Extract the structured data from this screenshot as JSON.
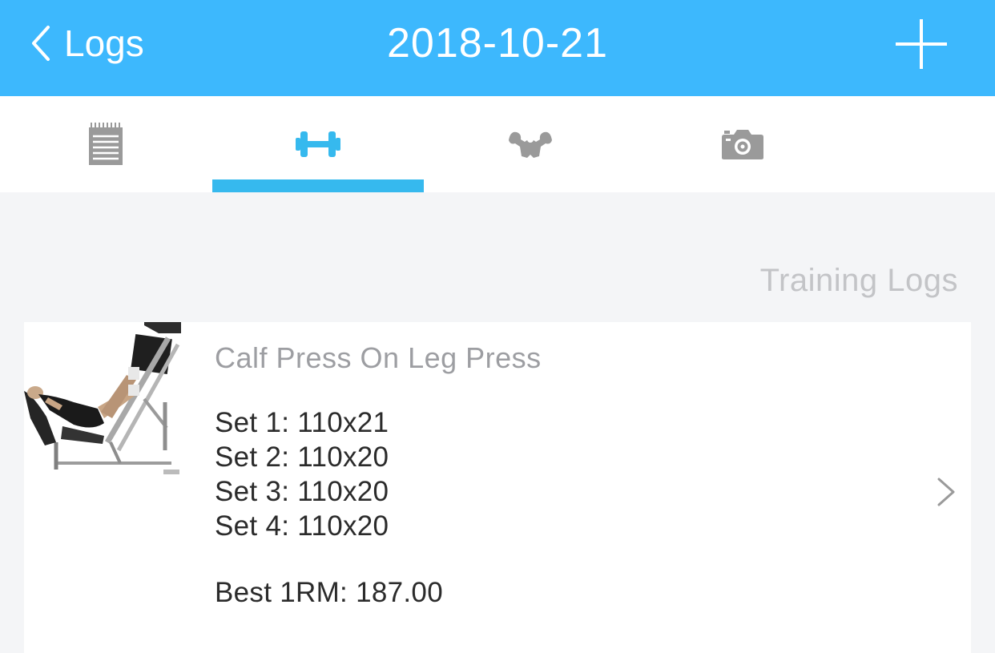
{
  "nav": {
    "back_label": "Logs",
    "title": "2018-10-21",
    "add_icon": "plus-icon",
    "bar_color": "#3db8fd"
  },
  "tabs": [
    {
      "icon": "notepad-icon",
      "active": false
    },
    {
      "icon": "dumbbell-icon",
      "active": true
    },
    {
      "icon": "muscle-icon",
      "active": false
    },
    {
      "icon": "camera-icon",
      "active": false
    }
  ],
  "colors": {
    "active_tab": "#36b9ee",
    "inactive_tab": "#9a9a9a"
  },
  "section": {
    "header": "Training Logs"
  },
  "entry": {
    "exercise_name": "Calf Press On Leg Press",
    "sets": [
      "Set 1: 110x21",
      "Set 2: 110x20",
      "Set 3: 110x20",
      "Set 4: 110x20"
    ],
    "best_1rm": "Best 1RM: 187.00"
  }
}
